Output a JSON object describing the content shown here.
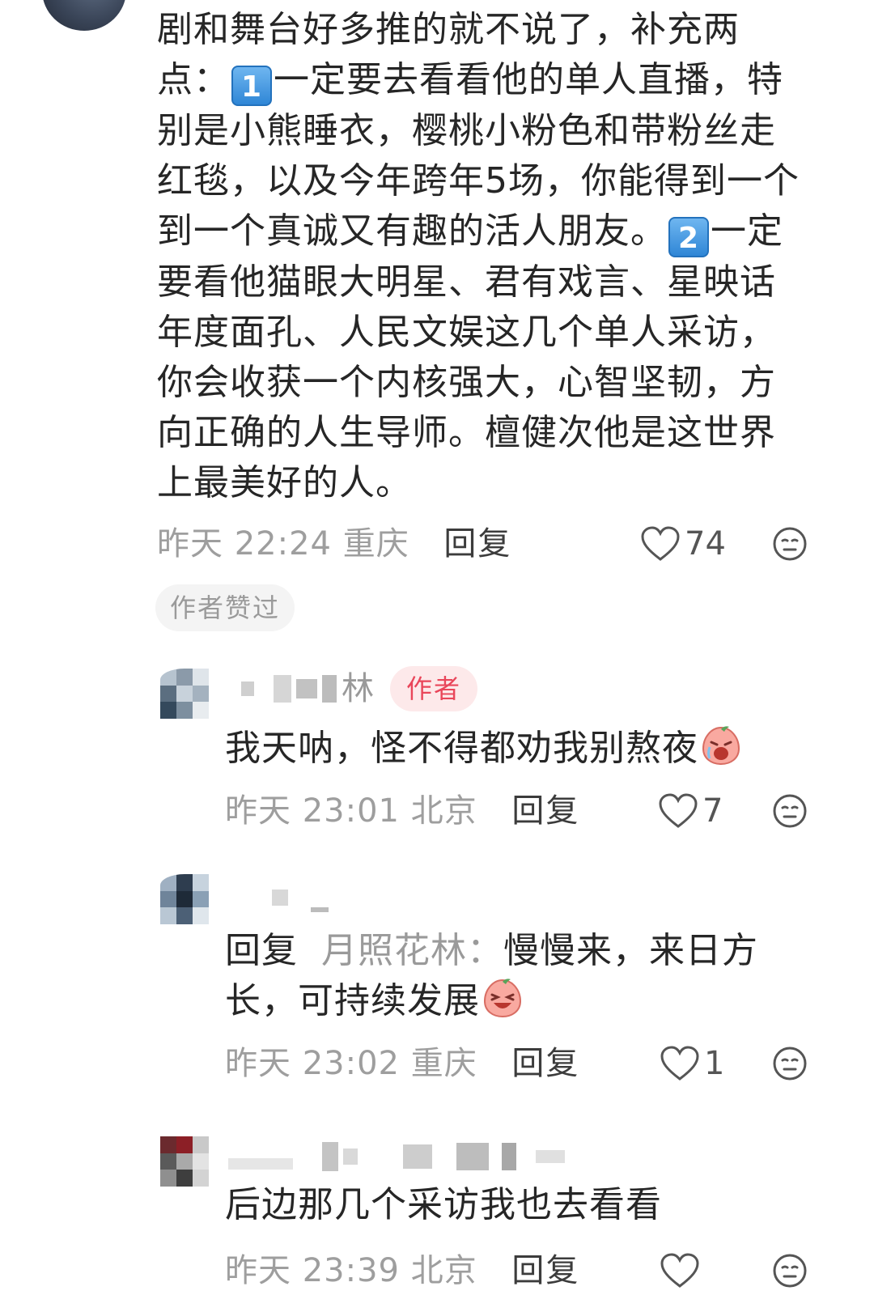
{
  "main_comment": {
    "body_line_1": "剧和舞台好多推的就不说了，补充两",
    "body_line_2a": "点：",
    "keycap_1": "1",
    "body_line_2b": "一定要去看看他的单人直播，特",
    "body_line_3": "别是小熊睡衣，樱桃小粉色和带粉丝走",
    "body_line_4": "红毯，以及今年跨年5场，你能得到一个",
    "body_line_5a": "到一个真诚又有趣的活人朋友。",
    "keycap_2": "2",
    "body_line_5b": "一定",
    "body_line_6": "要看他猫眼大明星、君有戏言、星映话",
    "body_line_7": "年度面孔、人民文娱这几个单人采访，",
    "body_line_8": "你会收获一个内核强大，心智坚韧，方",
    "body_line_9": "向正确的人生导师。檀健次他是这世界",
    "body_line_10": "上最美好的人。",
    "time": "昨天 22:24 重庆",
    "reply_label": "回复",
    "likes": "74",
    "author_liked_label": "作者赞过"
  },
  "replies": [
    {
      "name_suffix": "林",
      "author_badge": "作者",
      "text": "我天呐，怪不得都劝我别熬夜",
      "time": "昨天 23:01 北京",
      "reply_label": "回复",
      "likes": "7"
    },
    {
      "prefix": "回复",
      "mention": "月照花林：",
      "text_line_1": "慢慢来，来日方",
      "text_line_2": "长，可持续发展",
      "time": "昨天 23:02 重庆",
      "reply_label": "回复",
      "likes": "1"
    },
    {
      "text": "后边那几个采访我也去看看",
      "time": "昨天 23:39 北京",
      "reply_label": "回复"
    }
  ],
  "icons": {
    "like": "heart-outline-icon",
    "dislike": "neutral-face-icon",
    "emoji_1": "crying-peach-emoji",
    "emoji_2": "laughing-peach-emoji"
  },
  "colors": {
    "badge_text": "#e9465a",
    "badge_bg": "#fde9ea",
    "meta_text": "#9e9e9e",
    "keycap_blue": "#2f86d6"
  }
}
